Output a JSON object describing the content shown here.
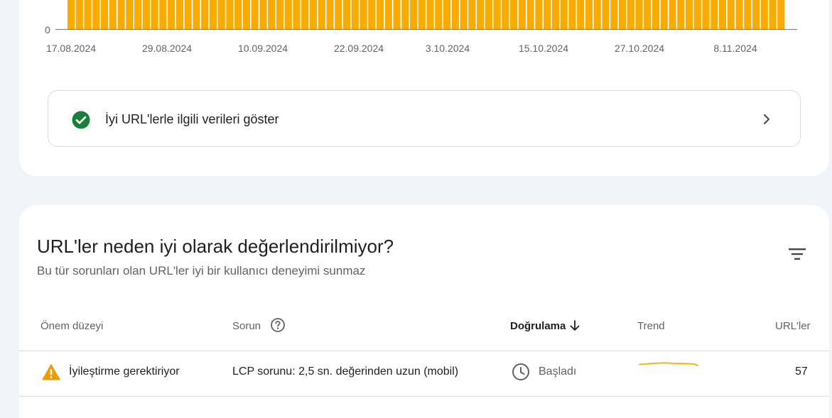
{
  "chart_data": {
    "type": "bar",
    "x_start_label": "17.08.2024",
    "tick_labels": [
      "17.08.2024",
      "29.08.2024",
      "10.09.2024",
      "22.09.2024",
      "3.10.2024",
      "15.10.2024",
      "27.10.2024",
      "8.11.2024"
    ],
    "y_axis_label": "0",
    "bar_count": 86,
    "bar_color": "#f9ab00",
    "baseline_color": "#80868b"
  },
  "good_urls": {
    "label": "İyi URL'lerle ilgili verileri göster",
    "icon": "check-circle-icon",
    "icon_color": "#188038"
  },
  "issues": {
    "title": "URL'ler neden iyi olarak değerlendirilmiyor?",
    "subtitle": "Bu tür sorunları olan URL'ler iyi bir kullanıcı deneyimi sunmaz",
    "columns": {
      "severity": "Önem düzeyi",
      "issue": "Sorun",
      "validation": "Doğrulama",
      "trend": "Trend",
      "urls": "URL'ler"
    },
    "rows": [
      {
        "severity": "İyileştirme gerektiriyor",
        "severity_icon": "warning-icon",
        "severity_color": "#f29900",
        "issue": "LCP sorunu: 2,5 sn. değerinden uzun (mobil)",
        "validation": "Başladı",
        "validation_icon": "clock-icon",
        "trend_color": "#f9ab00",
        "urls": "57"
      }
    ]
  }
}
